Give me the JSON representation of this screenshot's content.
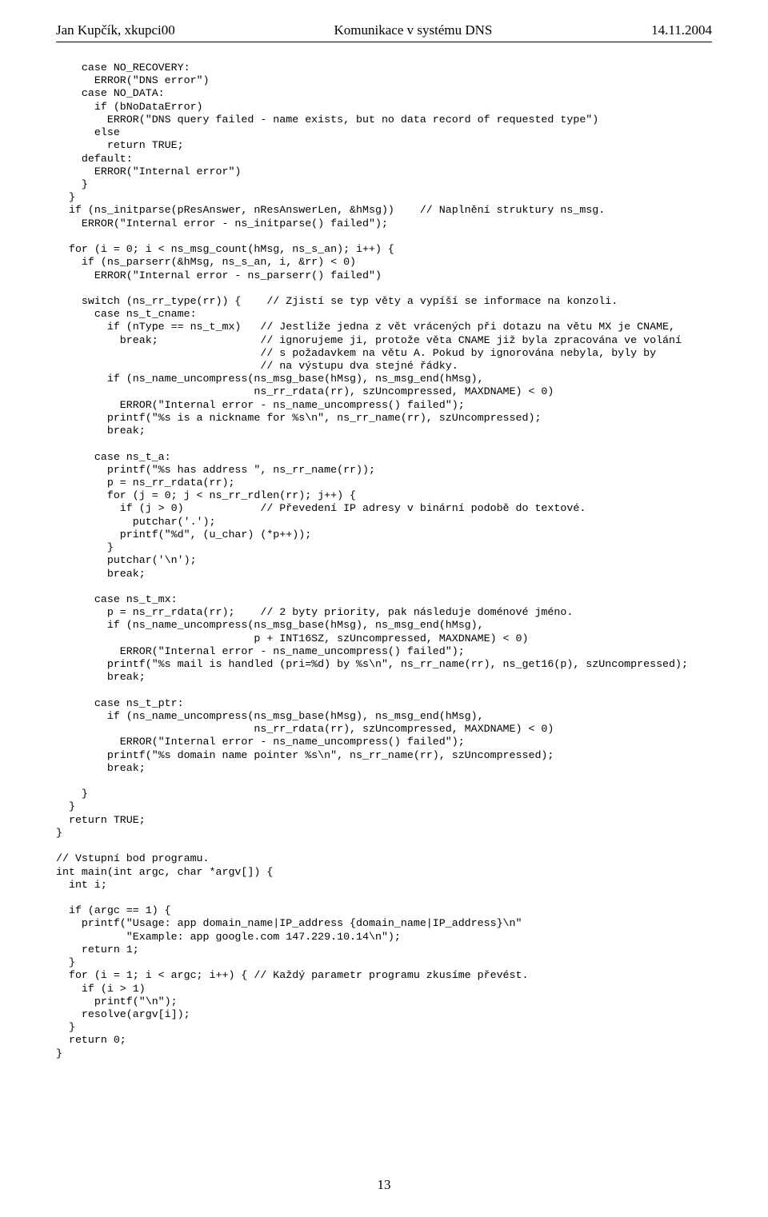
{
  "header": {
    "left": "Jan Kupčík, xkupci00",
    "mid": "Komunikace v systému DNS",
    "right": "14.11.2004"
  },
  "code_lines": [
    "    case NO_RECOVERY:",
    "      ERROR(\"DNS error\")",
    "    case NO_DATA:",
    "      if (bNoDataError)",
    "        ERROR(\"DNS query failed - name exists, but no data record of requested type\")",
    "      else",
    "        return TRUE;",
    "    default:",
    "      ERROR(\"Internal error\")",
    "    }",
    "  }",
    "  if (ns_initparse(pResAnswer, nResAnswerLen, &hMsg))    // Naplnění struktury ns_msg.",
    "    ERROR(\"Internal error - ns_initparse() failed\");",
    "",
    "  for (i = 0; i < ns_msg_count(hMsg, ns_s_an); i++) {",
    "    if (ns_parserr(&hMsg, ns_s_an, i, &rr) < 0)",
    "      ERROR(\"Internal error - ns_parserr() failed\")",
    "",
    "    switch (ns_rr_type(rr)) {    // Zjistí se typ věty a vypíší se informace na konzoli.",
    "      case ns_t_cname:",
    "        if (nType == ns_t_mx)   // Jestliže jedna z vět vrácených při dotazu na větu MX je CNAME,",
    "          break;                // ignorujeme ji, protože věta CNAME již byla zpracována ve volání",
    "                                // s požadavkem na větu A. Pokud by ignorována nebyla, byly by",
    "                                // na výstupu dva stejné řádky.",
    "        if (ns_name_uncompress(ns_msg_base(hMsg), ns_msg_end(hMsg),",
    "                               ns_rr_rdata(rr), szUncompressed, MAXDNAME) < 0)",
    "          ERROR(\"Internal error - ns_name_uncompress() failed\");",
    "        printf(\"%s is a nickname for %s\\n\", ns_rr_name(rr), szUncompressed);",
    "        break;",
    "",
    "      case ns_t_a:",
    "        printf(\"%s has address \", ns_rr_name(rr));",
    "        p = ns_rr_rdata(rr);",
    "        for (j = 0; j < ns_rr_rdlen(rr); j++) {",
    "          if (j > 0)            // Převedení IP adresy v binární podobě do textové.",
    "            putchar('.');",
    "          printf(\"%d\", (u_char) (*p++));",
    "        }",
    "        putchar('\\n');",
    "        break;",
    "",
    "      case ns_t_mx:",
    "        p = ns_rr_rdata(rr);    // 2 byty priority, pak následuje doménové jméno.",
    "        if (ns_name_uncompress(ns_msg_base(hMsg), ns_msg_end(hMsg),",
    "                               p + INT16SZ, szUncompressed, MAXDNAME) < 0)",
    "          ERROR(\"Internal error - ns_name_uncompress() failed\");",
    "        printf(\"%s mail is handled (pri=%d) by %s\\n\", ns_rr_name(rr), ns_get16(p), szUncompressed);",
    "        break;",
    "",
    "      case ns_t_ptr:",
    "        if (ns_name_uncompress(ns_msg_base(hMsg), ns_msg_end(hMsg),",
    "                               ns_rr_rdata(rr), szUncompressed, MAXDNAME) < 0)",
    "          ERROR(\"Internal error - ns_name_uncompress() failed\");",
    "        printf(\"%s domain name pointer %s\\n\", ns_rr_name(rr), szUncompressed);",
    "        break;",
    "",
    "    }",
    "  }",
    "  return TRUE;",
    "}",
    "",
    "// Vstupní bod programu.",
    "int main(int argc, char *argv[]) {",
    "  int i;",
    "",
    "  if (argc == 1) {",
    "    printf(\"Usage: app domain_name|IP_address {domain_name|IP_address}\\n\"",
    "           \"Example: app google.com 147.229.10.14\\n\");",
    "    return 1;",
    "  }",
    "  for (i = 1; i < argc; i++) { // Každý parametr programu zkusíme převést.",
    "    if (i > 1)",
    "      printf(\"\\n\");",
    "    resolve(argv[i]);",
    "  }",
    "  return 0;",
    "}"
  ],
  "footer": {
    "page_number": "13"
  }
}
